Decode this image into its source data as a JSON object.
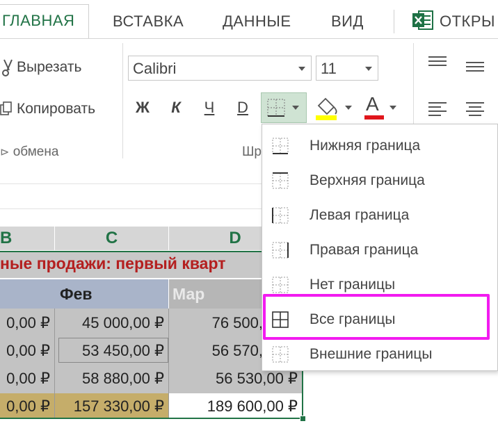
{
  "tabs": {
    "home": "ГЛАВНАЯ",
    "insert": "ВСТАВКА",
    "data": "ДАННЫЕ",
    "view": "ВИД",
    "open": "ОТКРЫ"
  },
  "clipboard": {
    "cut": "Вырезать",
    "copy": "Копировать",
    "group_label": "обмена"
  },
  "font": {
    "name": "Calibri",
    "size": "11",
    "bold": "Ж",
    "italic": "К",
    "underline": "Ч",
    "strike": "D",
    "group_label": "Шр"
  },
  "columns": [
    "B",
    "C",
    "D"
  ],
  "sheet": {
    "title_fragment": "ные продажи: первый кварт",
    "header_feb": "Фев",
    "header_mar": "Мар",
    "rows": [
      {
        "b": "0,00 ₽",
        "c": "45 000,00 ₽",
        "d": "76 500,"
      },
      {
        "b": "0,00 ₽",
        "c": "53 450,00 ₽",
        "d": "56 570,"
      },
      {
        "b": "0,00 ₽",
        "c": "58 880,00 ₽",
        "d": "56 530,00 ₽"
      },
      {
        "b": "0,00 ₽",
        "c": "157 330,00 ₽",
        "d": "189 600,00 ₽"
      }
    ]
  },
  "border_menu": {
    "items": [
      "Нижняя граница",
      "Верхняя граница",
      "Левая граница",
      "Правая граница",
      "Нет границы",
      "Все границы",
      "Внешние границы"
    ],
    "highlighted_index": 5
  },
  "colors": {
    "accent_green": "#217346",
    "highlight_magenta": "#f21bf0",
    "title_red": "#b41f1f"
  }
}
